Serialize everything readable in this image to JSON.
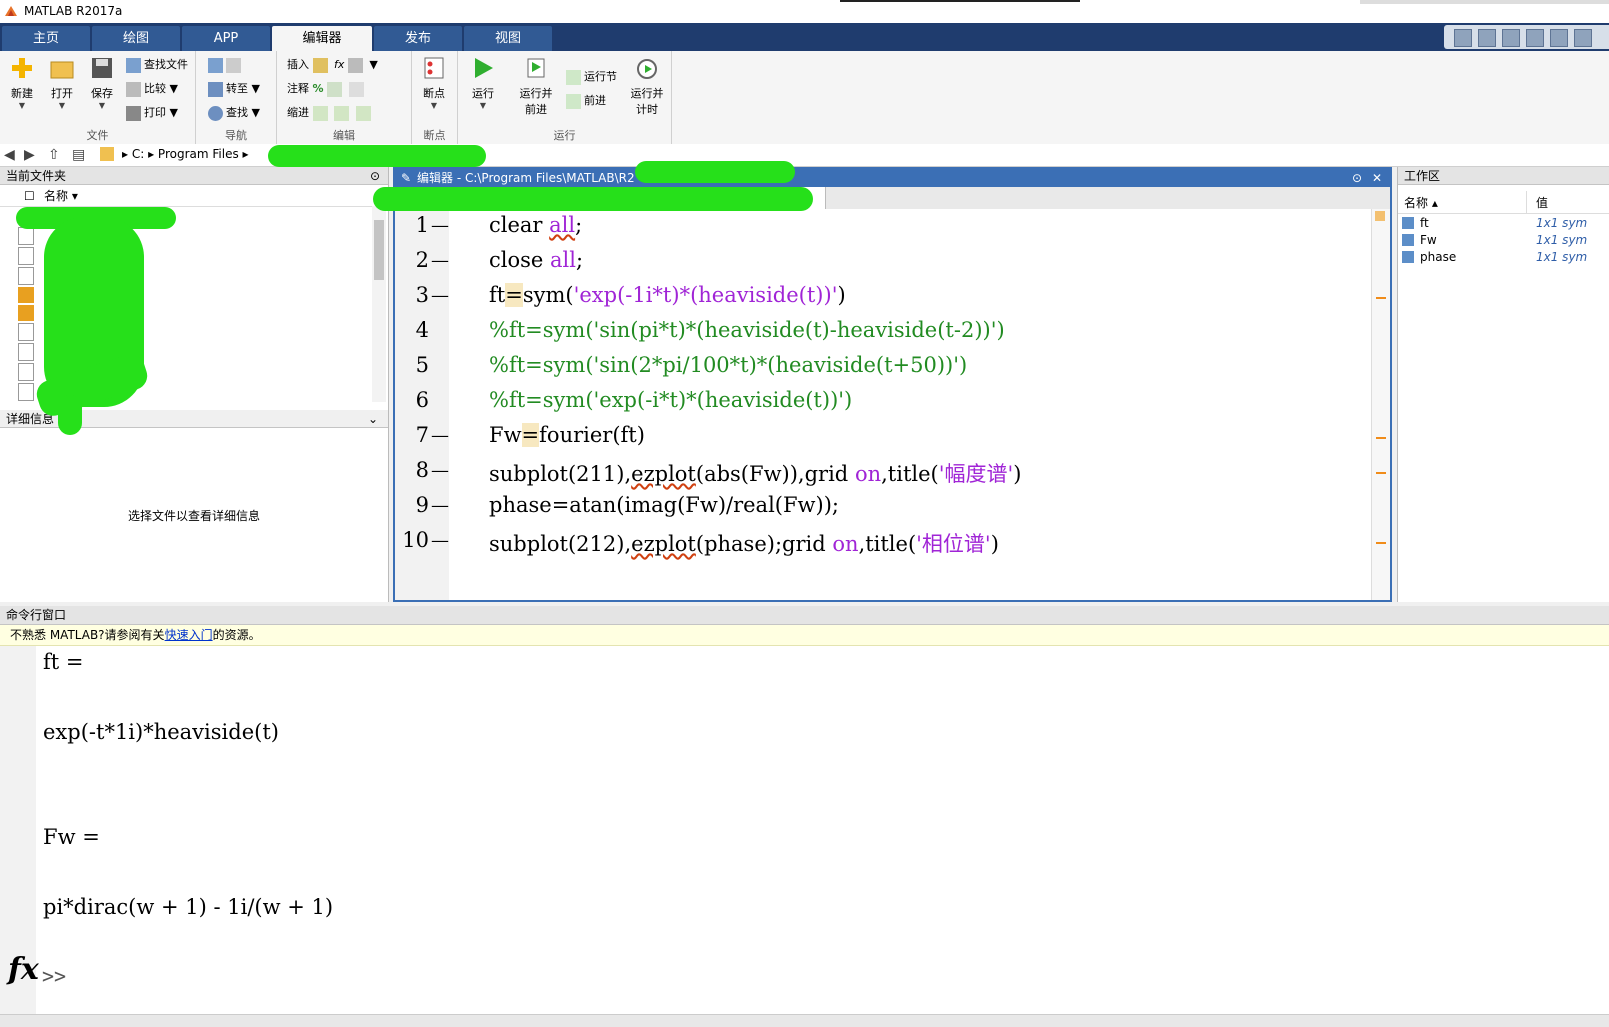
{
  "window": {
    "title": "MATLAB R2017a"
  },
  "tabs": [
    {
      "label": "主页"
    },
    {
      "label": "绘图"
    },
    {
      "label": "APP"
    },
    {
      "label": "编辑器"
    },
    {
      "label": "发布"
    },
    {
      "label": "视图"
    }
  ],
  "ribbon": {
    "file": {
      "new": "新建",
      "open": "打开",
      "save": "保存",
      "find_files": "查找文件",
      "compare": "比较",
      "print": "打印",
      "caption": "文件"
    },
    "navigate": {
      "goto": "转至",
      "find": "查找",
      "caption": "导航"
    },
    "edit": {
      "insert": "插入",
      "comment": "注释",
      "indent": "缩进",
      "caption": "编辑"
    },
    "breakpoints": {
      "label": "断点",
      "caption": "断点"
    },
    "run": {
      "run": "运行",
      "run_advance_1": "运行并",
      "run_advance_2": "前进",
      "run_section": "运行节",
      "advance": "前进",
      "run_time_1": "运行并",
      "run_time_2": "计时",
      "caption": "运行"
    }
  },
  "address": {
    "parts": [
      "C:",
      "Program Files"
    ]
  },
  "current_folder": {
    "title": "当前文件夹",
    "column_name": "名称",
    "details_title": "详细信息",
    "details_placeholder": "选择文件以查看详细信息"
  },
  "editor": {
    "title": "编辑器 - C:\\Program Files\\MATLAB\\R2",
    "lines": [
      "1",
      "2",
      "3",
      "4",
      "5",
      "6",
      "7",
      "8",
      "9",
      "10"
    ]
  },
  "workspace": {
    "title": "工作区",
    "col_name": "名称",
    "col_value": "值",
    "vars": [
      {
        "name": "ft",
        "value": "1x1 sym"
      },
      {
        "name": "Fw",
        "value": "1x1 sym"
      },
      {
        "name": "phase",
        "value": "1x1 sym"
      }
    ]
  },
  "command": {
    "title": "命令行窗口",
    "info_prefix": "不熟悉 MATLAB?请参阅有关",
    "info_link": "快速入门",
    "info_suffix": "的资源。",
    "output": [
      "ft =",
      "exp(-t*1i)*heaviside(t)",
      "Fw =",
      "pi*dirac(w + 1) - 1i/(w + 1)"
    ],
    "prompt": ">>",
    "fx": "fx"
  },
  "colors": {
    "accent": "#3b6fb5",
    "tabbar": "#1f3c6e",
    "scribble": "#26e01a"
  }
}
